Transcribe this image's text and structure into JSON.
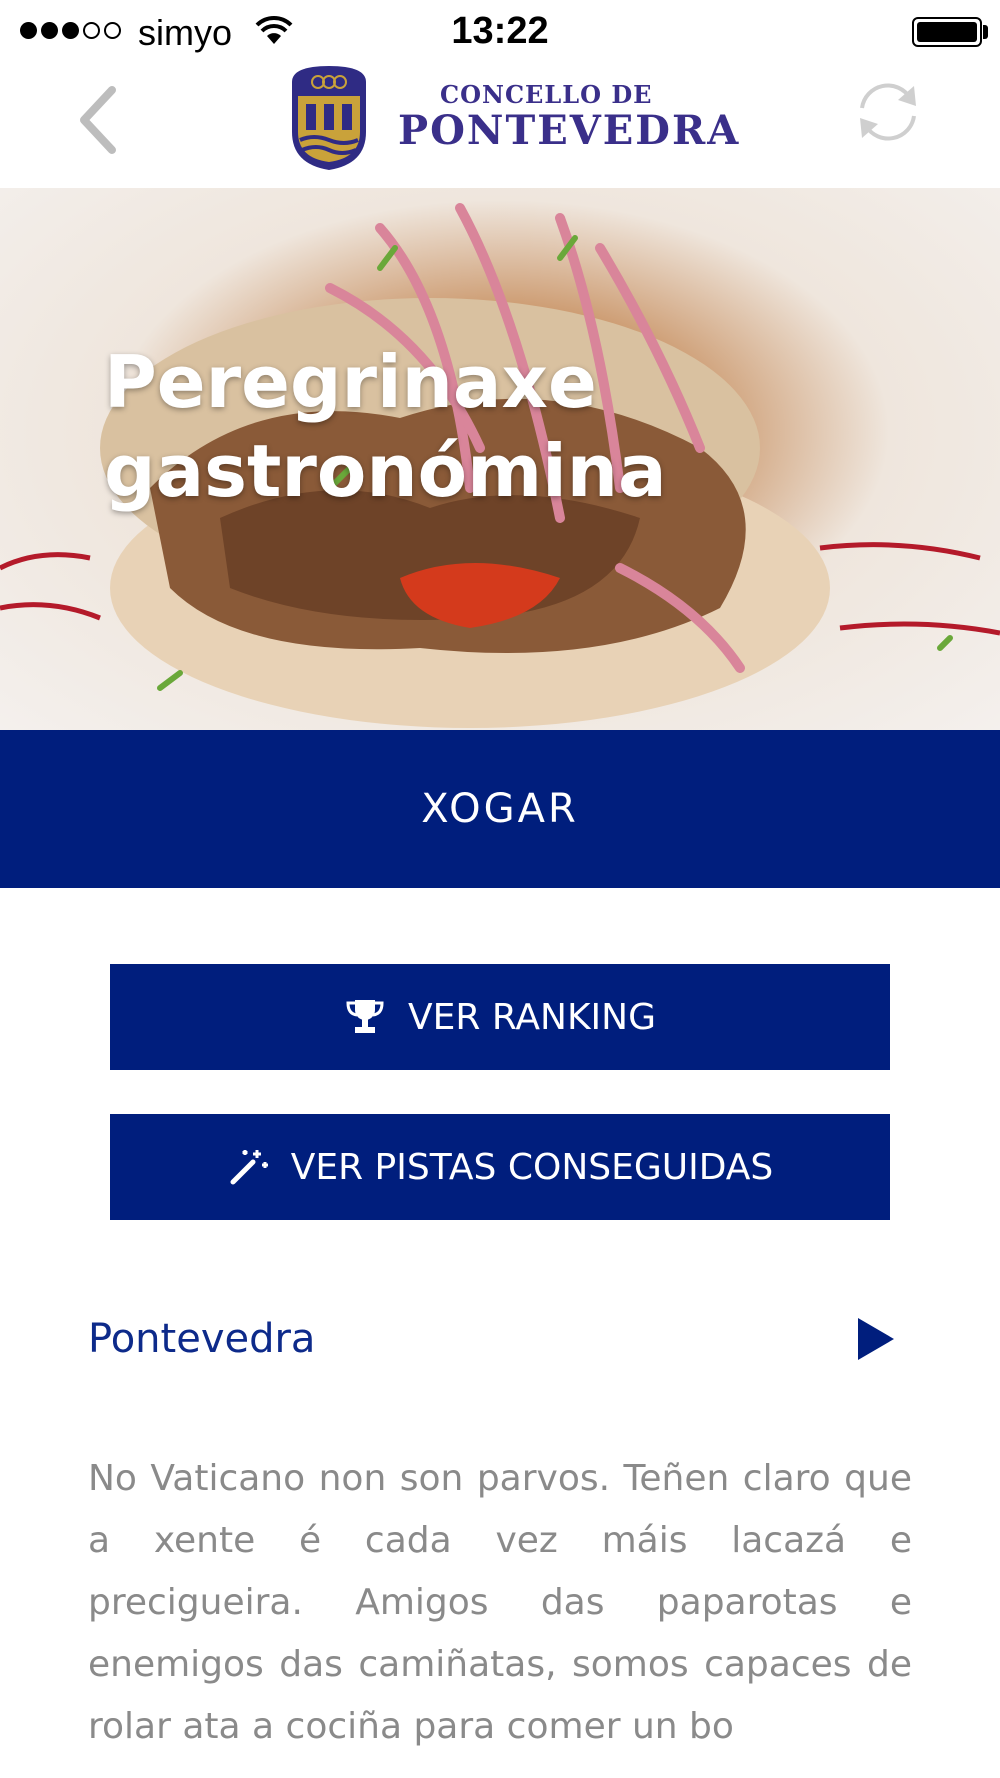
{
  "status_bar": {
    "signal_filled": 3,
    "signal_total": 5,
    "carrier": "simyo",
    "time": "13:22",
    "battery_level": 1.0
  },
  "header": {
    "back_icon": "chevron-left-icon",
    "logo_line1": "CONCELLO DE",
    "logo_line2": "PONTEVEDRA",
    "refresh_icon": "refresh-icon"
  },
  "hero": {
    "title": "Peregrinaxe gastronómina"
  },
  "actions": {
    "play_label": "XOGAR",
    "ranking_label": "VER RANKING",
    "ranking_icon": "trophy-icon",
    "clues_label": "VER PISTAS CONSEGUIDAS",
    "clues_icon": "magic-wand-icon"
  },
  "location": {
    "label": "Pontevedra",
    "icon": "play-arrow-icon"
  },
  "description": "No Vaticano non son parvos. Teñen claro que a xente é cada vez máis lacazá e precigueira. Amigos das paparotas e enemigos das camiñatas, somos capaces de rolar ata a cociña para comer un bo",
  "colors": {
    "primary": "#001e7d",
    "logo": "#3a2f8a",
    "link": "#0d2a8a",
    "body_text": "#8a8a8a"
  }
}
